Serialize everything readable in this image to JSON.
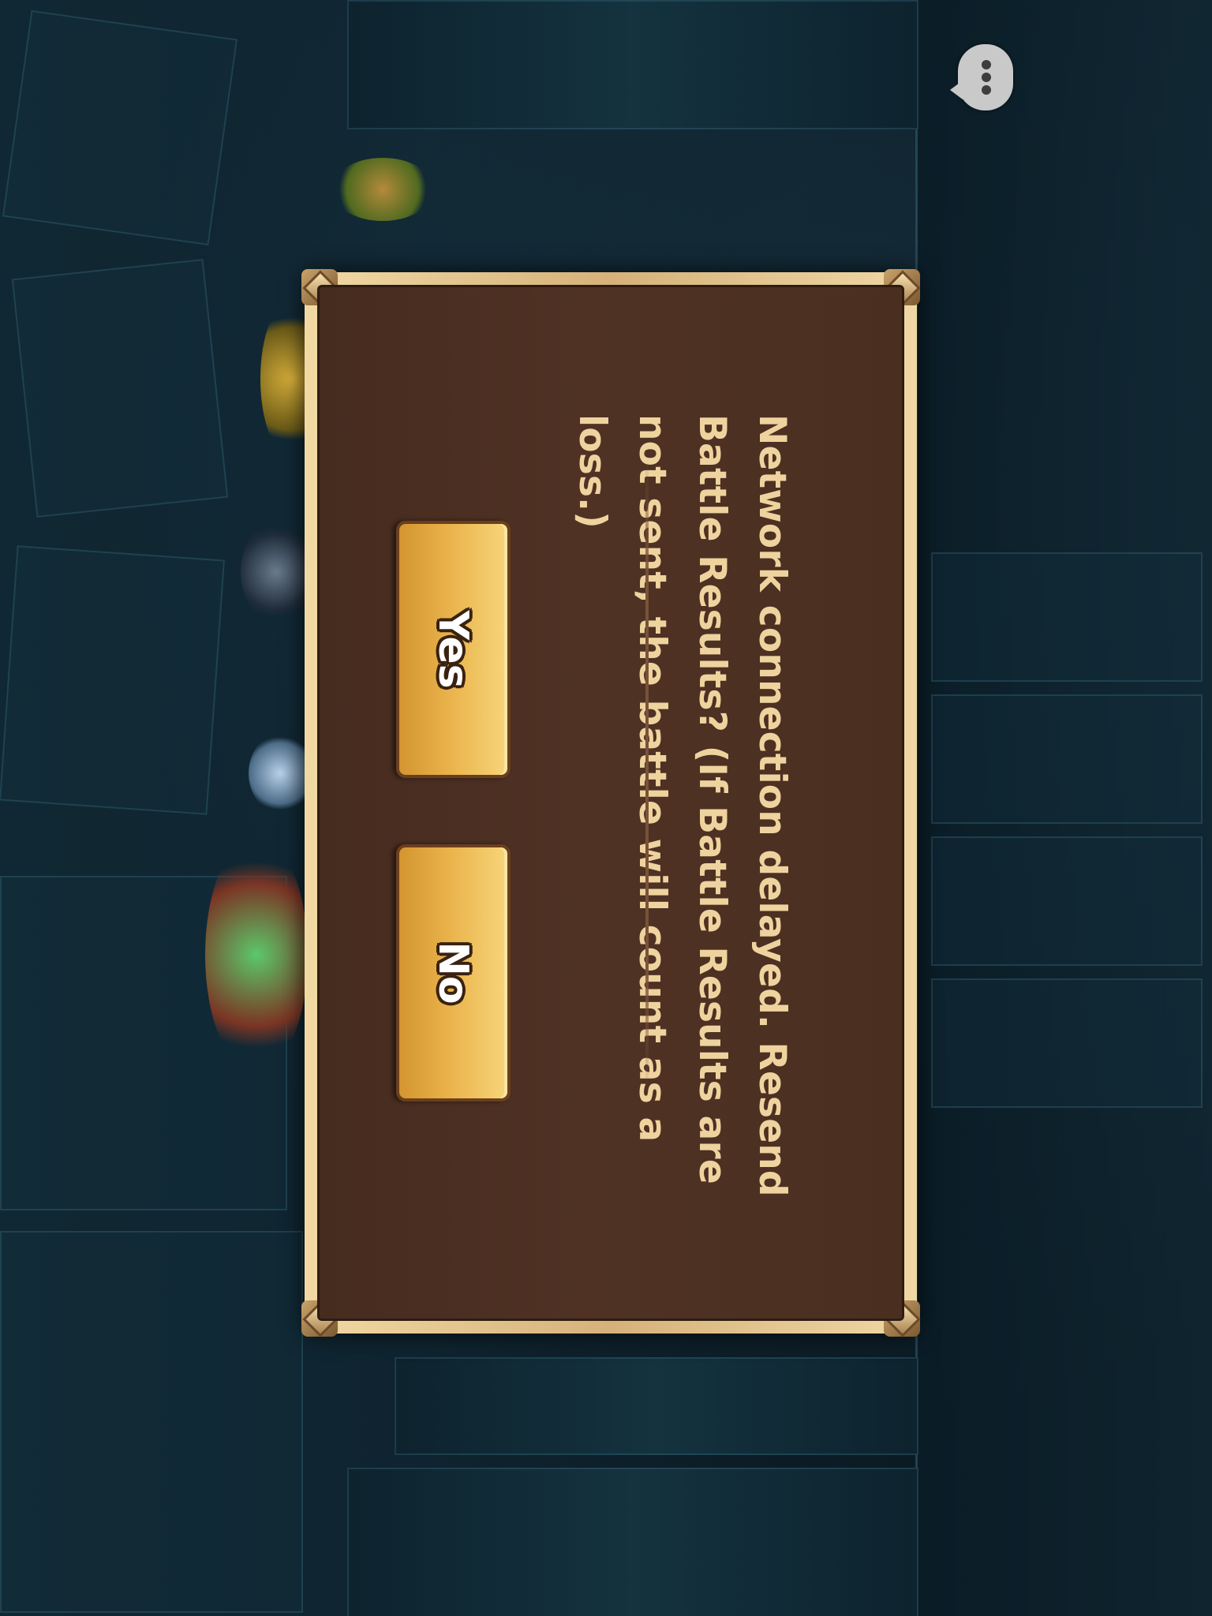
{
  "chat": {
    "icon": "chat-bubble-icon"
  },
  "dialog": {
    "message": "Network connection delayed. Resend Battle Results? (If Battle Results are not sent, the battle will count as a loss.)",
    "yes_label": "Yes",
    "no_label": "No"
  },
  "colors": {
    "dialog_bg": "#4f3224",
    "dialog_frame": "#d6b27a",
    "message_text": "#efd39f",
    "button_gold": "#e9b24a"
  }
}
